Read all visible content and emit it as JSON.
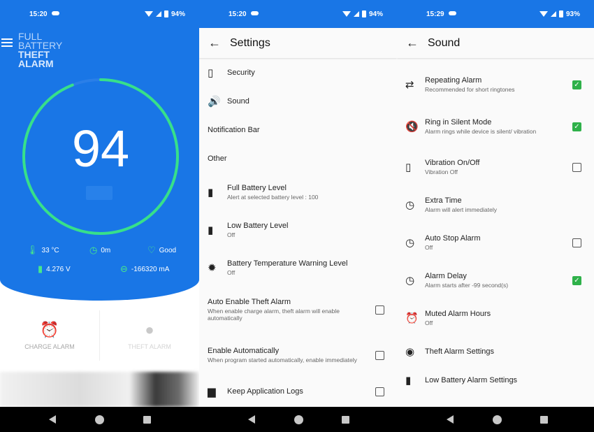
{
  "colors": {
    "primary": "#1976e6",
    "accent_green": "#2fb14a",
    "gauge_green": "#37e08a"
  },
  "screen1": {
    "status": {
      "time": "15:20",
      "battery": "94%"
    },
    "logo": [
      "FULL",
      "BATTERY",
      "THEFT",
      "ALARM"
    ],
    "battery_level": "94",
    "battery_level_fraction": 0.94,
    "stats": {
      "temperature": "33 °C",
      "time": "0m",
      "health": "Good",
      "voltage": "4.276 V",
      "current": "-166320 mA"
    },
    "tabs": {
      "charge_alarm": "CHARGE ALARM",
      "theft_alarm": "THEFT ALARM"
    },
    "icons": [
      "menu-icon",
      "thermometer-icon",
      "timer-icon",
      "heart-icon",
      "battery-icon",
      "current-icon",
      "alarm-clock-icon",
      "user-icon"
    ]
  },
  "screen2": {
    "status": {
      "time": "15:20",
      "battery": "94%"
    },
    "title": "Settings",
    "items": [
      {
        "title": "Security",
        "icon": "phone-lock-icon"
      },
      {
        "title": "Sound",
        "icon": "volume-icon"
      },
      {
        "title": "Notification Bar"
      },
      {
        "title": "Other"
      },
      {
        "title": "Full Battery Level",
        "subtitle": "Alert at selected battery level : 100",
        "icon": "battery-charging-icon"
      },
      {
        "title": "Low Battery Level",
        "subtitle": "Off",
        "icon": "battery-low-icon"
      },
      {
        "title": "Battery Temperature Warning Level",
        "subtitle": "Off",
        "icon": "temperature-alert-icon"
      },
      {
        "title": "Auto Enable Theft Alarm",
        "subtitle": "When enable charge alarm, theft alarm will enable automatically",
        "checked": false
      },
      {
        "title": "Enable Automatically",
        "subtitle": "When program started automatically, enable immediately",
        "checked": false
      },
      {
        "title": "Keep Application Logs",
        "icon": "file-icon",
        "checked": false
      }
    ]
  },
  "screen3": {
    "status": {
      "time": "15:29",
      "battery": "93%"
    },
    "title": "Sound",
    "items": [
      {
        "title": "Repeating Alarm",
        "subtitle": "Recommended for short ringtones",
        "icon": "repeat-icon",
        "checked": true
      },
      {
        "title": "Ring in Silent Mode",
        "subtitle": "Alarm rings while device is silent/ vibration",
        "icon": "volume-off-icon",
        "checked": true
      },
      {
        "title": "Vibration On/Off",
        "subtitle": "Vibration Off",
        "icon": "vibration-icon",
        "checked": false
      },
      {
        "title": "Extra Time",
        "subtitle": "Alarm will alert immediately",
        "icon": "clock-icon"
      },
      {
        "title": "Auto Stop Alarm",
        "subtitle": "Off",
        "icon": "clock-icon",
        "checked": false
      },
      {
        "title": "Alarm Delay",
        "subtitle": "Alarm starts after -99 second(s)",
        "icon": "clock-icon",
        "checked": true
      },
      {
        "title": "Muted Alarm Hours",
        "subtitle": "Off",
        "icon": "alarm-off-icon"
      },
      {
        "title": "Theft Alarm Settings",
        "icon": "eye-icon"
      },
      {
        "title": "Low Battery Alarm Settings",
        "icon": "battery-low-icon"
      }
    ]
  },
  "navbar": {
    "icons": [
      "back-icon",
      "home-icon",
      "recents-icon"
    ]
  }
}
